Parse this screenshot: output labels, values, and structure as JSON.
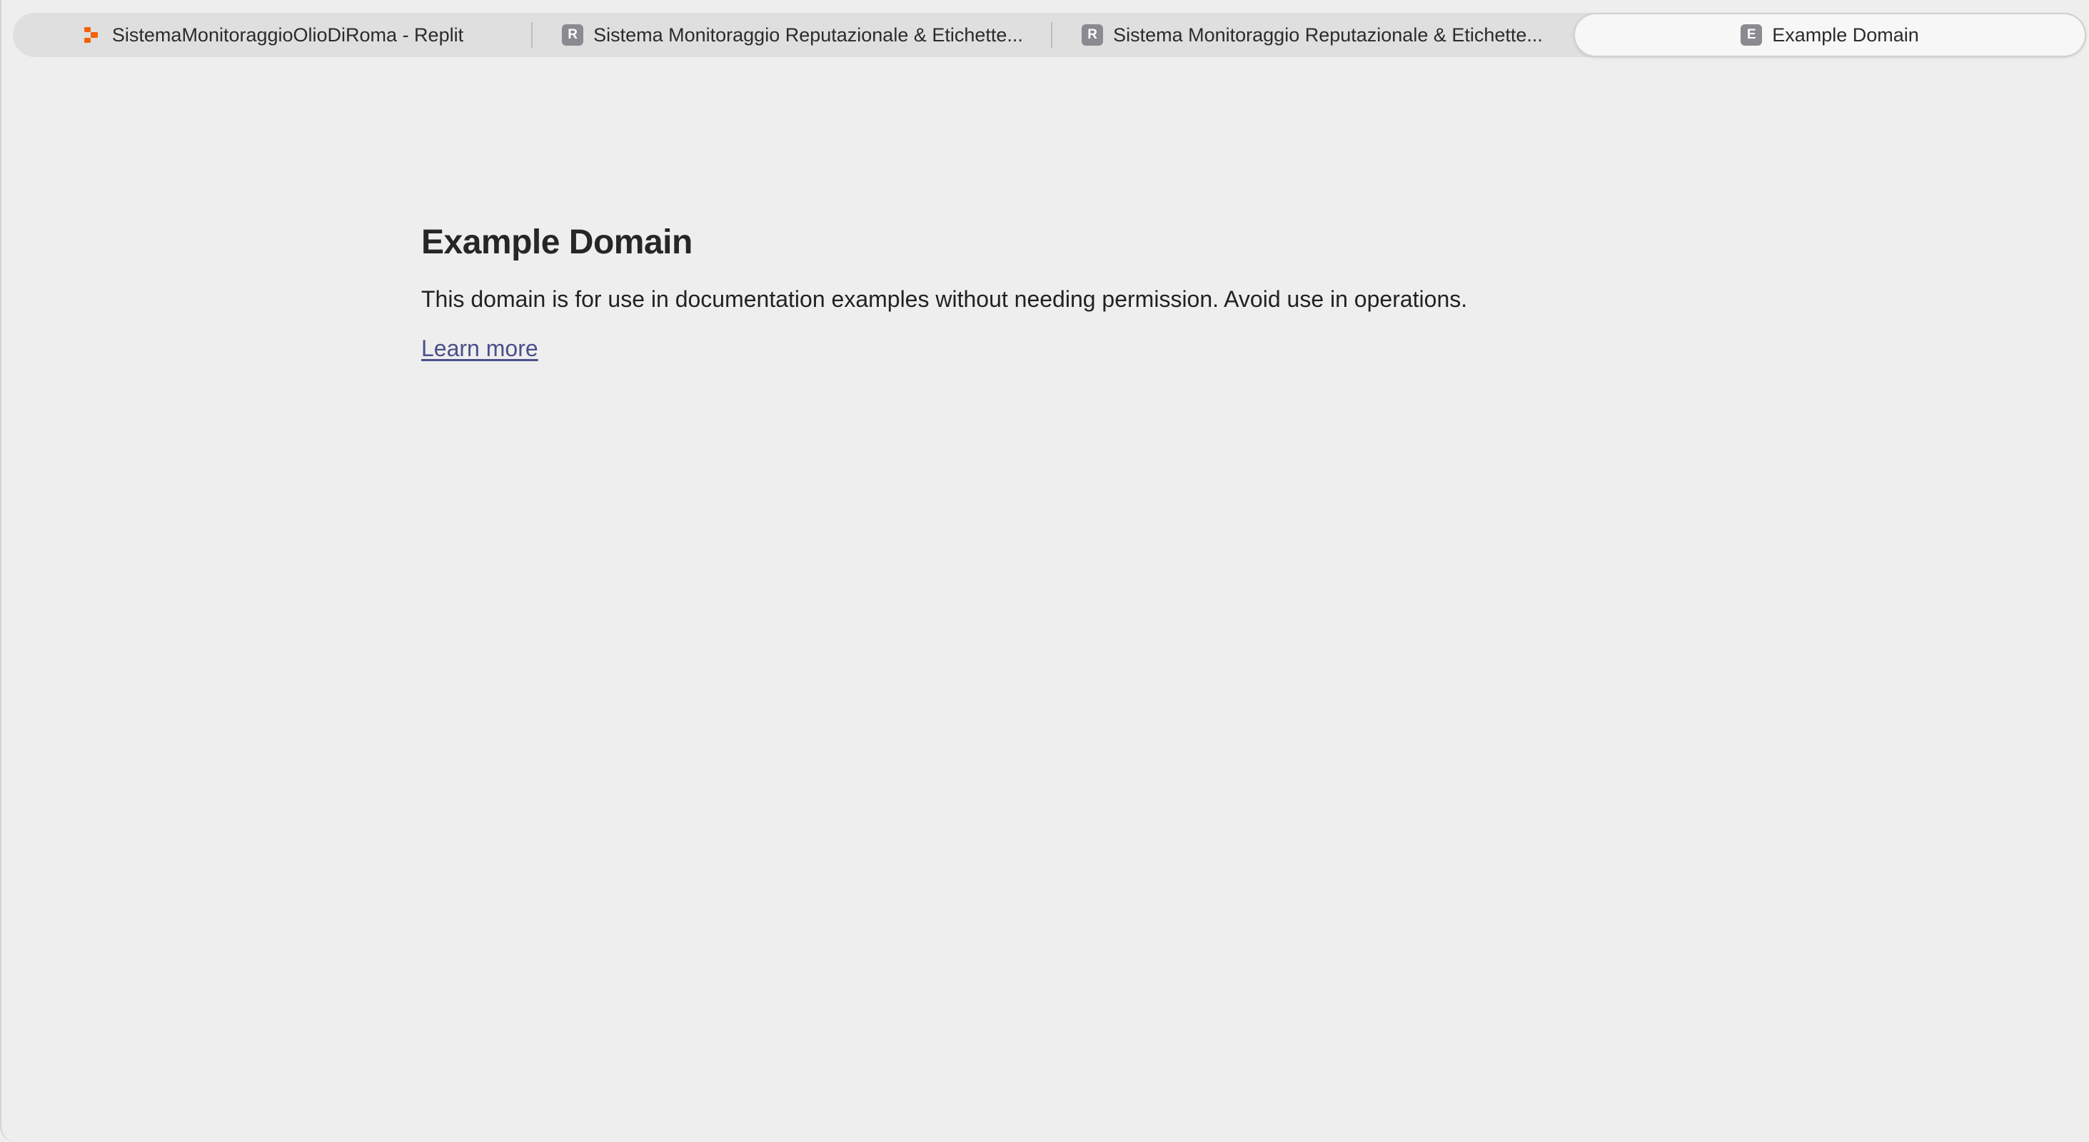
{
  "tabs": [
    {
      "label": "SistemaMonitoraggioOlioDiRoma - Replit",
      "icon": "replit-icon",
      "active": false
    },
    {
      "label": "Sistema Monitoraggio Reputazionale & Etichette...",
      "icon_letter": "R",
      "active": false
    },
    {
      "label": "Sistema Monitoraggio Reputazionale & Etichette...",
      "icon_letter": "R",
      "active": false
    },
    {
      "label": "Example Domain",
      "icon_letter": "E",
      "active": true
    }
  ],
  "page": {
    "heading": "Example Domain",
    "description": "This domain is for use in documentation examples without needing permission. Avoid use in operations.",
    "link_text": "Learn more"
  },
  "colors": {
    "background": "#eeeeee",
    "link": "#4a4f8c",
    "replit_brand": "#f26207"
  }
}
